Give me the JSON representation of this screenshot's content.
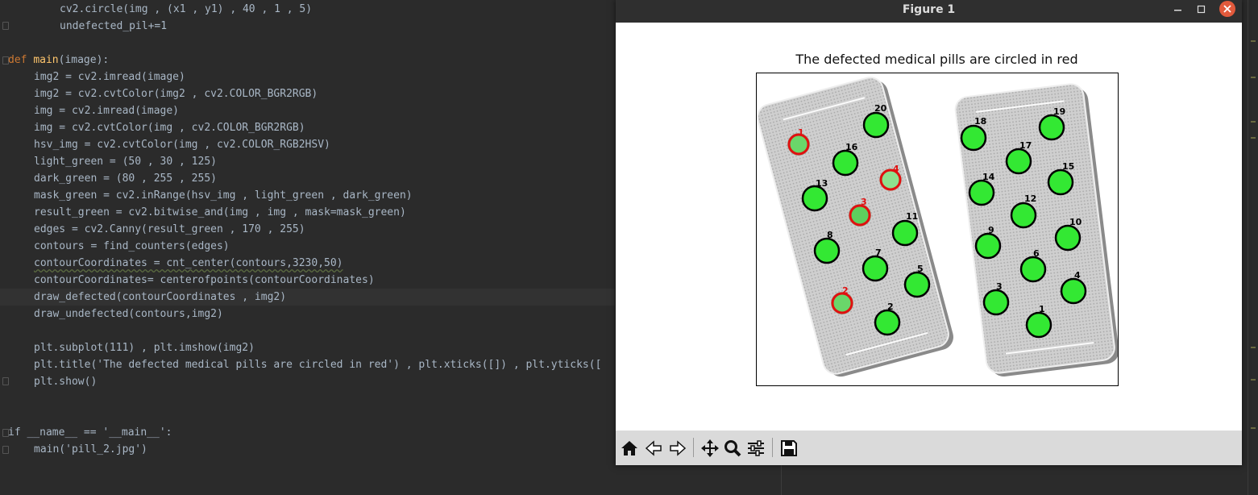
{
  "editor": {
    "lines": [
      "cv2.circle(img , (x1 , y1) , 40 , 1 , 5)",
      "undefected_pil+=1",
      "",
      "def main(image):",
      "img2 = cv2.imread(image)",
      "img2 = cv2.cvtColor(img2 , cv2.COLOR_BGR2RGB)",
      "img = cv2.imread(image)",
      "img = cv2.cvtColor(img , cv2.COLOR_BGR2RGB)",
      "hsv_img = cv2.cvtColor(img , cv2.COLOR_RGB2HSV)",
      "light_green = (50 , 30 , 125)",
      "dark_green = (80 , 255 , 255)",
      "mask_green = cv2.inRange(hsv_img , light_green , dark_green)",
      "result_green = cv2.bitwise_and(img , img , mask=mask_green)",
      "edges = cv2.Canny(result_green , 170 , 255)",
      "contours = find_counters(edges)",
      "contourCoordinates = cnt_center(contours,3230,50)",
      "contourCoordinates= centerofpoints(contourCoordinates)",
      "draw_defected(contourCoordinates , img2)",
      "draw_undefected(contours,img2)",
      "",
      "plt.subplot(111) , plt.imshow(img2)",
      "plt.title('The defected medical pills are circled in red') , plt.xticks([]) , plt.yticks([",
      "plt.show()",
      "",
      "",
      "if __name__ == '__main__':",
      "main('pill_2.jpg')"
    ]
  },
  "figure": {
    "window_title": "Figure 1",
    "plot_title": "The defected medical pills are circled in red",
    "left_pack_labels": [
      "20",
      "1",
      "16",
      "4",
      "13",
      "3",
      "11",
      "8",
      "7",
      "5",
      "2",
      "2"
    ],
    "right_pack_labels": [
      "18",
      "19",
      "17",
      "14",
      "15",
      "12",
      "9",
      "10",
      "6",
      "3",
      "4",
      "1"
    ],
    "defected_labels": [
      "1",
      "4",
      "3",
      "2"
    ],
    "colors": {
      "pill": "#33e833",
      "defect_ring": "#e01010",
      "pack": "#c8c8c8"
    },
    "toolbar": [
      "home-icon",
      "back-icon",
      "forward-icon",
      "pan-icon",
      "zoom-icon",
      "configure-icon",
      "save-icon"
    ]
  }
}
